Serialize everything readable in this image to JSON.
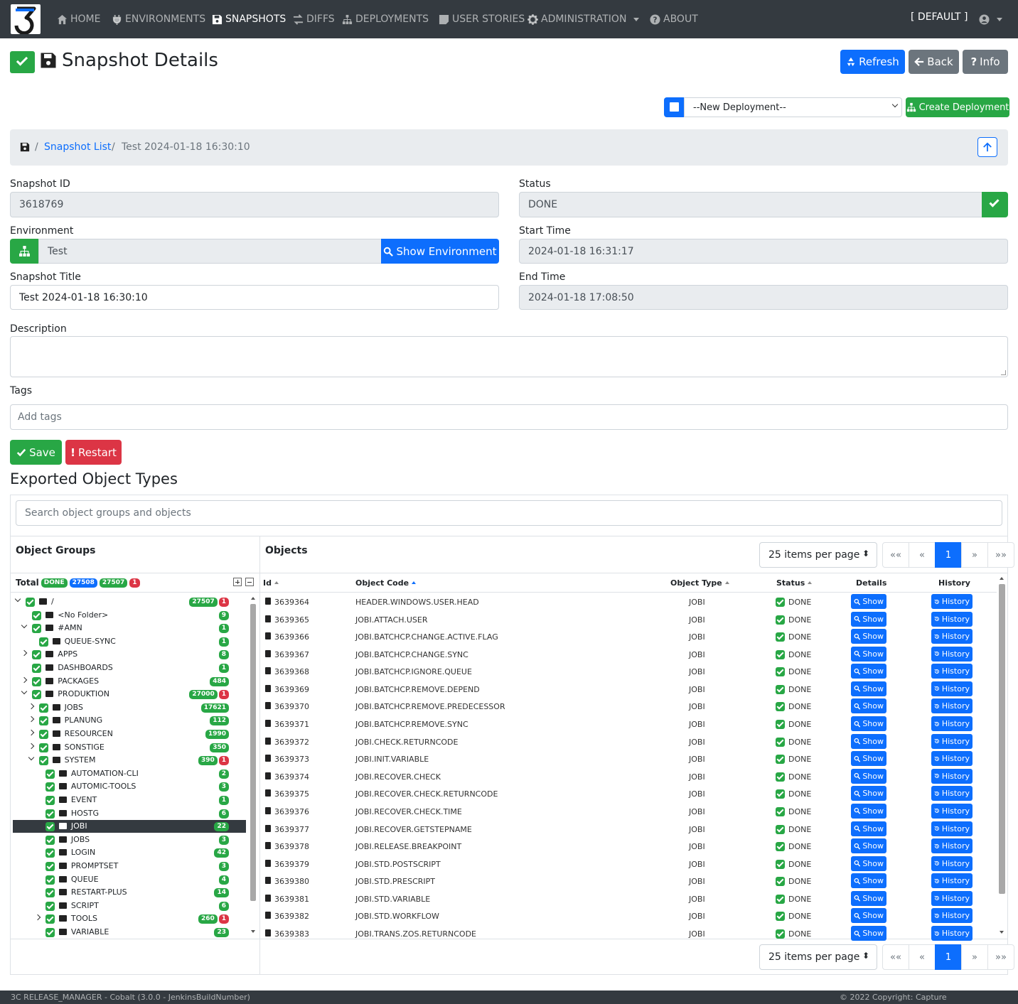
{
  "nav": {
    "items": [
      {
        "label": "HOME",
        "icon": "home-icon"
      },
      {
        "label": "ENVIRONMENTS",
        "icon": "plug-icon"
      },
      {
        "label": "SNAPSHOTS",
        "icon": "save-icon"
      },
      {
        "label": "DIFFS",
        "icon": "diffs-icon"
      },
      {
        "label": "DEPLOYMENTS",
        "icon": "sitemap-icon"
      },
      {
        "label": "USER STORIES",
        "icon": "sticky-note-icon"
      },
      {
        "label": "ADMINISTRATION",
        "icon": "gear-icon"
      },
      {
        "label": "ABOUT",
        "icon": "question-icon"
      }
    ],
    "tenant": "[ DEFAULT ]"
  },
  "header": {
    "title": "Snapshot Details",
    "refresh": "Refresh",
    "back": "Back",
    "info": "Info"
  },
  "deploy": {
    "select_value": "--New Deployment--",
    "create": "Create Deployment"
  },
  "breadcrumb": {
    "list": "Snapshot List",
    "current": "Test 2024-01-18 16:30:10",
    "sep": "/"
  },
  "form": {
    "snapshot_id_label": "Snapshot ID",
    "snapshot_id": "3618769",
    "status_label": "Status",
    "status": "DONE",
    "environment_label": "Environment",
    "environment": "Test",
    "show_env": "Show Environment",
    "start_label": "Start Time",
    "start": "2024-01-18 16:31:17",
    "title_label": "Snapshot Title",
    "title": "Test 2024-01-18 16:30:10",
    "end_label": "End Time",
    "end": "2024-01-18 17:08:50",
    "description_label": "Description",
    "tags_label": "Tags",
    "tags_placeholder": "Add tags",
    "save": "Save",
    "restart": "Restart"
  },
  "exported": {
    "title": "Exported Object Types",
    "search_placeholder": "Search object groups and objects",
    "groups_title": "Object Groups",
    "objects_title": "Objects",
    "total_label": "Total",
    "total_badges": [
      "DONE",
      "27508",
      "27507",
      "1"
    ]
  },
  "tree": [
    {
      "label": "/",
      "indent": 0,
      "arrow": "open",
      "open": true,
      "counts": [
        "27507",
        "1"
      ]
    },
    {
      "label": "<No Folder>",
      "indent": 1,
      "arrow": "",
      "counts": [
        "9"
      ]
    },
    {
      "label": "#AMN",
      "indent": 1,
      "arrow": "open",
      "open": true,
      "counts": [
        "1"
      ]
    },
    {
      "label": "QUEUE-SYNC",
      "indent": 2,
      "arrow": "",
      "counts": [
        "1"
      ]
    },
    {
      "label": "APPS",
      "indent": 1,
      "arrow": "closed",
      "counts": [
        "8"
      ]
    },
    {
      "label": "DASHBOARDS",
      "indent": 1,
      "arrow": "",
      "counts": [
        "1"
      ]
    },
    {
      "label": "PACKAGES",
      "indent": 1,
      "arrow": "closed",
      "counts": [
        "484"
      ]
    },
    {
      "label": "PRODUKTION",
      "indent": 1,
      "arrow": "open",
      "open": true,
      "counts": [
        "27000",
        "1"
      ]
    },
    {
      "label": "JOBS",
      "indent": 2,
      "arrow": "closed",
      "counts": [
        "17621"
      ]
    },
    {
      "label": "PLANUNG",
      "indent": 2,
      "arrow": "closed",
      "counts": [
        "112"
      ]
    },
    {
      "label": "RESOURCEN",
      "indent": 2,
      "arrow": "closed",
      "counts": [
        "1990"
      ]
    },
    {
      "label": "SONSTIGE",
      "indent": 2,
      "arrow": "closed",
      "counts": [
        "350"
      ]
    },
    {
      "label": "SYSTEM",
      "indent": 2,
      "arrow": "open",
      "open": true,
      "counts": [
        "390",
        "1"
      ]
    },
    {
      "label": "AUTOMATION-CLI",
      "indent": 3,
      "arrow": "",
      "counts": [
        "2"
      ]
    },
    {
      "label": "AUTOMIC-TOOLS",
      "indent": 3,
      "arrow": "",
      "counts": [
        "3"
      ]
    },
    {
      "label": "EVENT",
      "indent": 3,
      "arrow": "",
      "counts": [
        "1"
      ]
    },
    {
      "label": "HOSTG",
      "indent": 3,
      "arrow": "",
      "counts": [
        "6"
      ]
    },
    {
      "label": "JOBI",
      "indent": 3,
      "arrow": "",
      "counts": [
        "22"
      ],
      "selected": true
    },
    {
      "label": "JOBS",
      "indent": 3,
      "arrow": "",
      "counts": [
        "3"
      ]
    },
    {
      "label": "LOGIN",
      "indent": 3,
      "arrow": "",
      "counts": [
        "42"
      ]
    },
    {
      "label": "PROMPTSET",
      "indent": 3,
      "arrow": "",
      "counts": [
        "3"
      ]
    },
    {
      "label": "QUEUE",
      "indent": 3,
      "arrow": "",
      "counts": [
        "4"
      ]
    },
    {
      "label": "RESTART-PLUS",
      "indent": 3,
      "arrow": "",
      "counts": [
        "14"
      ]
    },
    {
      "label": "SCRIPT",
      "indent": 3,
      "arrow": "",
      "counts": [
        "6"
      ]
    },
    {
      "label": "TOOLS",
      "indent": 3,
      "arrow": "closed",
      "counts": [
        "260",
        "1"
      ]
    },
    {
      "label": "VARIABLE",
      "indent": 3,
      "arrow": "",
      "counts": [
        "23"
      ]
    }
  ],
  "table": {
    "headers": [
      "Id",
      "Object Code",
      "Object Type",
      "Status",
      "Details",
      "History"
    ],
    "show_label": "Show",
    "history_label": "History",
    "rows": [
      {
        "id": "3639364",
        "code": "HEADER.WINDOWS.USER.HEAD",
        "type": "JOBI",
        "status": "DONE"
      },
      {
        "id": "3639365",
        "code": "JOBI.ATTACH.USER",
        "type": "JOBI",
        "status": "DONE"
      },
      {
        "id": "3639366",
        "code": "JOBI.BATCHCP.CHANGE.ACTIVE.FLAG",
        "type": "JOBI",
        "status": "DONE"
      },
      {
        "id": "3639367",
        "code": "JOBI.BATCHCP.CHANGE.SYNC",
        "type": "JOBI",
        "status": "DONE"
      },
      {
        "id": "3639368",
        "code": "JOBI.BATCHCP.IGNORE.QUEUE",
        "type": "JOBI",
        "status": "DONE"
      },
      {
        "id": "3639369",
        "code": "JOBI.BATCHCP.REMOVE.DEPEND",
        "type": "JOBI",
        "status": "DONE"
      },
      {
        "id": "3639370",
        "code": "JOBI.BATCHCP.REMOVE.PREDECESSOR",
        "type": "JOBI",
        "status": "DONE"
      },
      {
        "id": "3639371",
        "code": "JOBI.BATCHCP.REMOVE.SYNC",
        "type": "JOBI",
        "status": "DONE"
      },
      {
        "id": "3639372",
        "code": "JOBI.CHECK.RETURNCODE",
        "type": "JOBI",
        "status": "DONE"
      },
      {
        "id": "3639373",
        "code": "JOBI.INIT.VARIABLE",
        "type": "JOBI",
        "status": "DONE"
      },
      {
        "id": "3639374",
        "code": "JOBI.RECOVER.CHECK",
        "type": "JOBI",
        "status": "DONE"
      },
      {
        "id": "3639375",
        "code": "JOBI.RECOVER.CHECK.RETURNCODE",
        "type": "JOBI",
        "status": "DONE"
      },
      {
        "id": "3639376",
        "code": "JOBI.RECOVER.CHECK.TIME",
        "type": "JOBI",
        "status": "DONE"
      },
      {
        "id": "3639377",
        "code": "JOBI.RECOVER.GETSTEPNAME",
        "type": "JOBI",
        "status": "DONE"
      },
      {
        "id": "3639378",
        "code": "JOBI.RELEASE.BREAKPOINT",
        "type": "JOBI",
        "status": "DONE"
      },
      {
        "id": "3639379",
        "code": "JOBI.STD.POSTSCRIPT",
        "type": "JOBI",
        "status": "DONE"
      },
      {
        "id": "3639380",
        "code": "JOBI.STD.PRESCRIPT",
        "type": "JOBI",
        "status": "DONE"
      },
      {
        "id": "3639381",
        "code": "JOBI.STD.VARIABLE",
        "type": "JOBI",
        "status": "DONE"
      },
      {
        "id": "3639382",
        "code": "JOBI.STD.WORKFLOW",
        "type": "JOBI",
        "status": "DONE"
      },
      {
        "id": "3639383",
        "code": "JOBI.TRANS.ZOS.RETURNCODE",
        "type": "JOBI",
        "status": "DONE"
      }
    ]
  },
  "pagination": {
    "items_per_page": "25 items per page",
    "first": "««",
    "prev": "«",
    "page": "1",
    "next": "»",
    "last": "»»"
  },
  "footer": {
    "left": "3C RELEASE_MANAGER - Cobalt (3.0.0 - JenkinsBuildNumber)",
    "right": "© 2022 Copyright: Capture"
  }
}
